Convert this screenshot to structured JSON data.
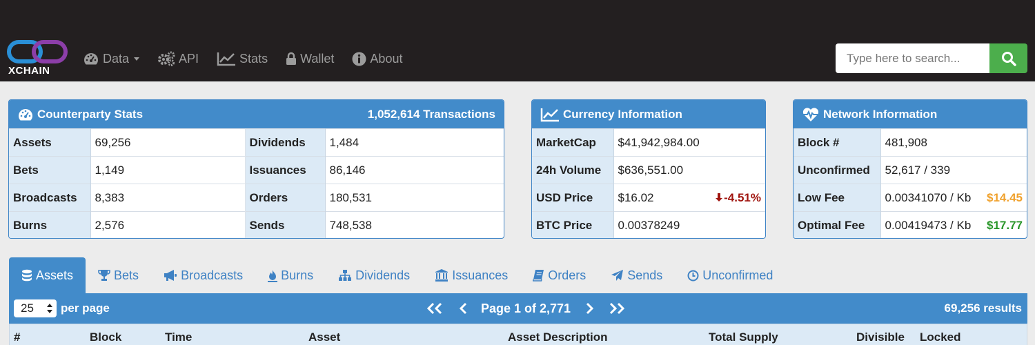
{
  "brand": {
    "name": "XCHAIN",
    "colors": {
      "blue": "#2a8fd6",
      "purple": "#8c3ea8"
    }
  },
  "nav": [
    {
      "label": "Data",
      "icon": "dashboard-icon",
      "dropdown": true
    },
    {
      "label": "API",
      "icon": "gears-icon"
    },
    {
      "label": "Stats",
      "icon": "line-chart-icon"
    },
    {
      "label": "Wallet",
      "icon": "lock-icon"
    },
    {
      "label": "About",
      "icon": "info-circle-icon"
    }
  ],
  "search": {
    "placeholder": "Type here to search...",
    "button_icon": "search-icon"
  },
  "counterparty": {
    "title": "Counterparty Stats",
    "transactions": "1,052,614 Transactions",
    "rows": [
      {
        "l1": "Assets",
        "v1": "69,256",
        "l2": "Dividends",
        "v2": "1,484"
      },
      {
        "l1": "Bets",
        "v1": "1,149",
        "l2": "Issuances",
        "v2": "86,146"
      },
      {
        "l1": "Broadcasts",
        "v1": "8,383",
        "l2": "Orders",
        "v2": "180,531"
      },
      {
        "l1": "Burns",
        "v1": "2,576",
        "l2": "Sends",
        "v2": "748,538"
      }
    ]
  },
  "currency": {
    "title": "Currency Information",
    "rows": [
      {
        "label": "MarketCap",
        "value": "$41,942,984.00"
      },
      {
        "label": "24h Volume",
        "value": "$636,551.00"
      },
      {
        "label": "USD Price",
        "value": "$16.02",
        "change": "-4.51%"
      },
      {
        "label": "BTC Price",
        "value": "0.00378249"
      }
    ]
  },
  "network": {
    "title": "Network Information",
    "rows": [
      {
        "label": "Block #",
        "value": "481,908"
      },
      {
        "label": "Unconfirmed",
        "value": "52,617 / 339"
      },
      {
        "label": "Low Fee",
        "value": "0.00341070 / Kb",
        "usd": "$14.45"
      },
      {
        "label": "Optimal Fee",
        "value": "0.00419473 / Kb",
        "usd": "$17.77"
      }
    ]
  },
  "tabs": [
    {
      "label": "Assets",
      "icon": "database-icon",
      "active": true
    },
    {
      "label": "Bets",
      "icon": "trophy-icon"
    },
    {
      "label": "Broadcasts",
      "icon": "bullhorn-icon"
    },
    {
      "label": "Burns",
      "icon": "fire-icon"
    },
    {
      "label": "Dividends",
      "icon": "sitemap-icon"
    },
    {
      "label": "Issuances",
      "icon": "bank-icon"
    },
    {
      "label": "Orders",
      "icon": "book-icon"
    },
    {
      "label": "Sends",
      "icon": "paper-plane-icon"
    },
    {
      "label": "Unconfirmed",
      "icon": "clock-icon"
    }
  ],
  "list": {
    "per_page_value": "25",
    "per_page_label": "per page",
    "page_text": "Page 1 of 2,771",
    "results": "69,256 results"
  },
  "table": {
    "columns": [
      "#",
      "Block",
      "Time",
      "Asset",
      "Asset Description",
      "Total Supply",
      "Divisible",
      "Locked"
    ]
  }
}
